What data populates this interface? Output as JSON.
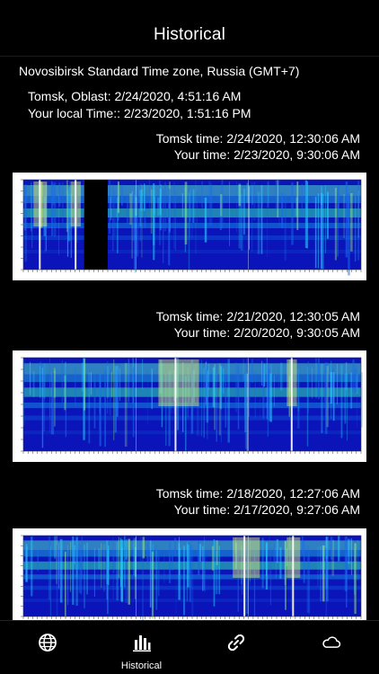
{
  "header": {
    "title": "Historical"
  },
  "timezone": {
    "label": "Novosibirsk Standard Time zone, Russia (GMT+7)"
  },
  "location": {
    "local_line": "Tomsk, Oblast: 2/24/2020, 4:51:16 AM",
    "user_line": "Your local Time:: 2/23/2020, 1:51:16 PM"
  },
  "entries": [
    {
      "tomsk": "Tomsk time: 2/24/2020, 12:30:06 AM",
      "yours": "Your time: 2/23/2020, 9:30:06 AM"
    },
    {
      "tomsk": "Tomsk time: 2/21/2020, 12:30:05 AM",
      "yours": "Your time: 2/20/2020, 9:30:05 AM"
    },
    {
      "tomsk": "Tomsk time: 2/18/2020, 12:27:06 AM",
      "yours": "Your time: 2/17/2020, 9:27:06 AM"
    }
  ],
  "tabs": [
    {
      "icon": "globe-icon",
      "label": ""
    },
    {
      "icon": "bar-chart-icon",
      "label": "Historical"
    },
    {
      "icon": "link-icon",
      "label": ""
    },
    {
      "icon": "cloud-icon",
      "label": ""
    }
  ],
  "colors": {
    "background": "#000000",
    "text": "#ffffff"
  }
}
